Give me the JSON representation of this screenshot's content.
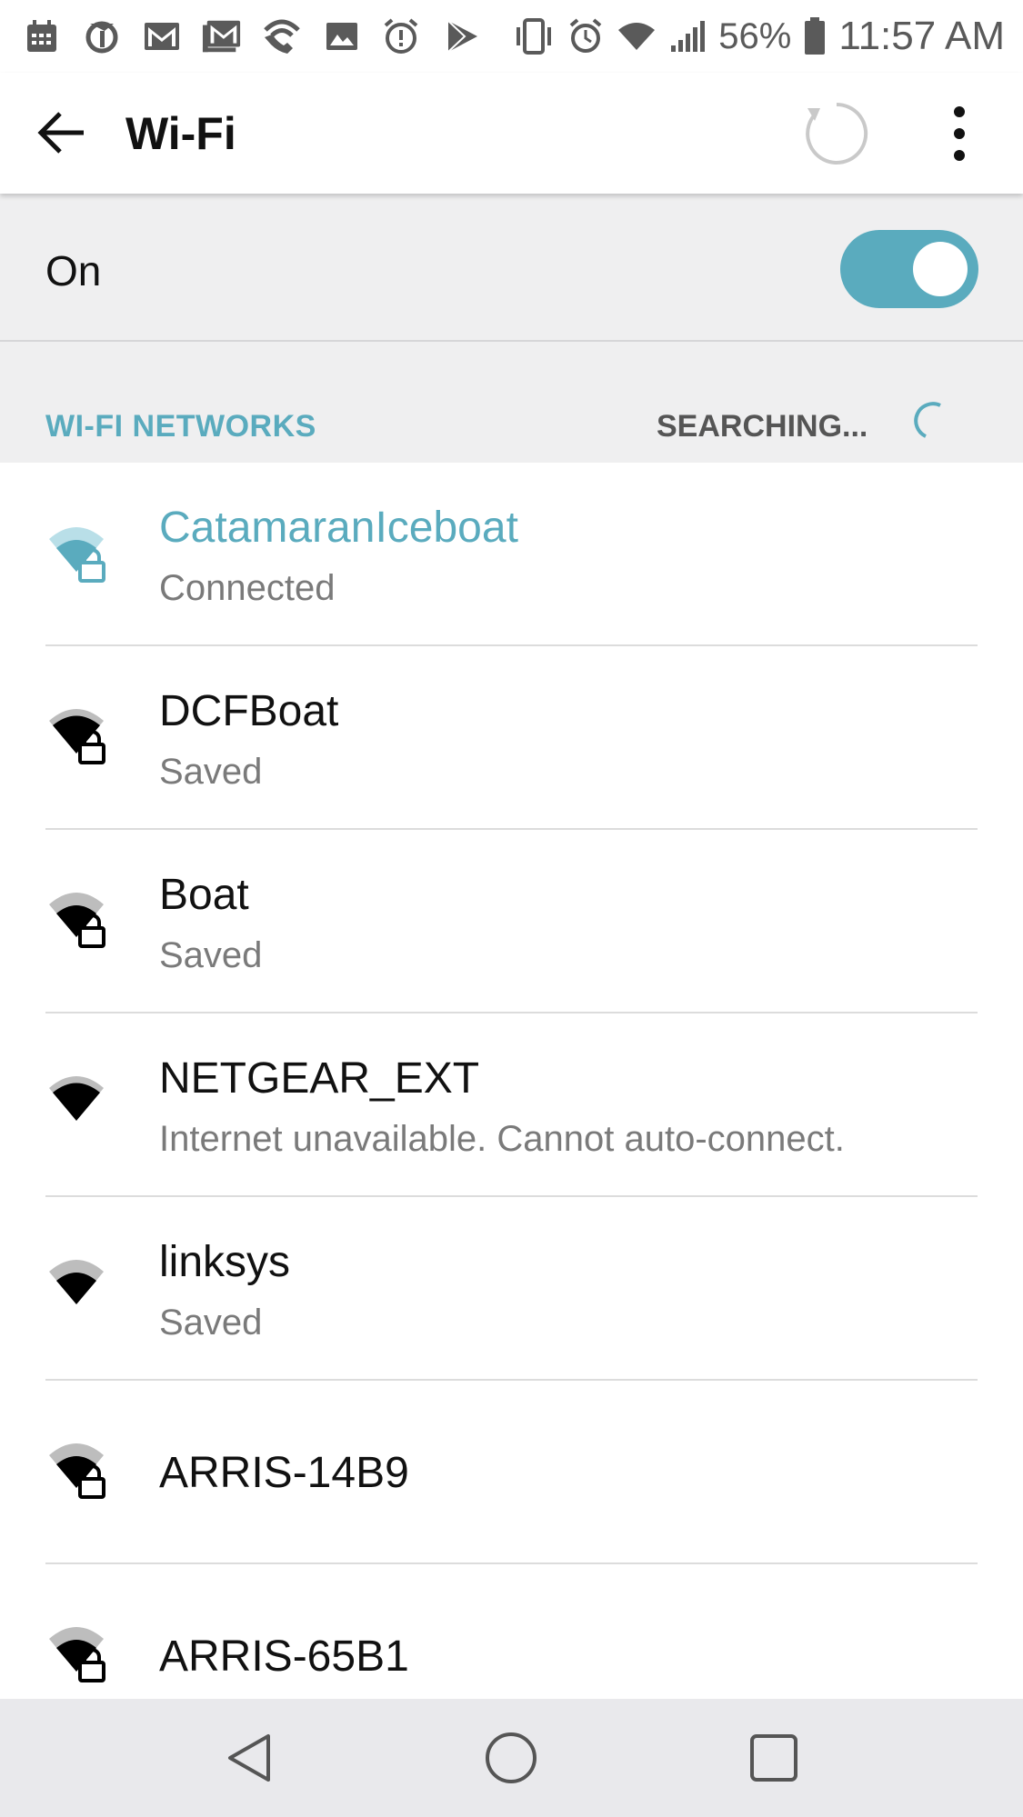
{
  "status_bar": {
    "left_icons": [
      "calendar-icon",
      "nyt-icon",
      "gmail-icon",
      "gmail-icon",
      "wifi-calling-icon",
      "image-icon",
      "alarm-alert-icon",
      "play-store-icon"
    ],
    "battery_percent": "56%",
    "time": "11:57 AM"
  },
  "app_bar": {
    "title": "Wi-Fi"
  },
  "wifi_toggle": {
    "label": "On",
    "state": true,
    "accent_color": "#5aabbe"
  },
  "section": {
    "title": "WI-FI NETWORKS",
    "status": "SEARCHING..."
  },
  "networks": [
    {
      "name": "CatamaranIceboat",
      "status": "Connected",
      "secured": true,
      "signal": 2,
      "connected": true
    },
    {
      "name": "DCFBoat",
      "status": "Saved",
      "secured": true,
      "signal": 3,
      "connected": false
    },
    {
      "name": "Boat",
      "status": "Saved",
      "secured": true,
      "signal": 2,
      "connected": false
    },
    {
      "name": "NETGEAR_EXT",
      "status": "Internet unavailable. Cannot auto-connect.",
      "secured": false,
      "signal": 3,
      "connected": false
    },
    {
      "name": "linksys",
      "status": "Saved",
      "secured": false,
      "signal": 2,
      "connected": false
    },
    {
      "name": "ARRIS-14B9",
      "status": "",
      "secured": true,
      "signal": 2,
      "connected": false
    },
    {
      "name": "ARRIS-65B1",
      "status": "",
      "secured": true,
      "signal": 2,
      "connected": false
    }
  ],
  "colors": {
    "accent": "#5aabbe",
    "section_bg": "#efeff0",
    "nav_bg": "#e9e9ec"
  }
}
